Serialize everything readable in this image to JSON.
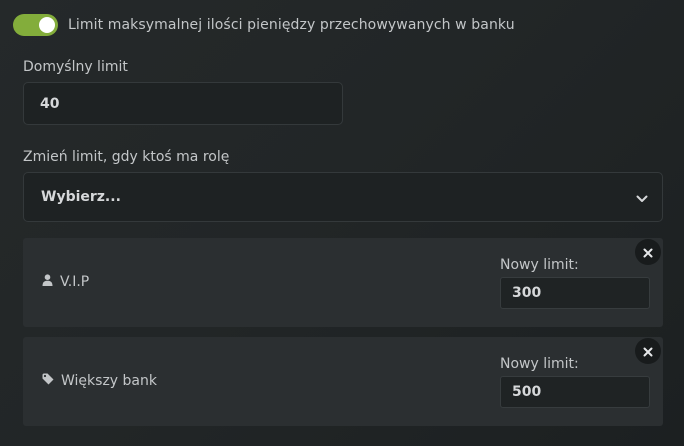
{
  "toggle": {
    "label": "Limit maksymalnej ilości pieniędzy przechowywanych w banku",
    "enabled": true,
    "color": "#83ad3b"
  },
  "default_limit": {
    "label": "Domyślny limit",
    "value": "40"
  },
  "role_select": {
    "label": "Zmień limit, gdy ktoś ma rolę",
    "placeholder": "Wybierz...",
    "icon": "chevron-down-icon"
  },
  "roles": [
    {
      "name": "V.I.P",
      "icon": "user-icon",
      "new_limit_label": "Nowy limit:",
      "value": "300",
      "remove_icon": "close-icon"
    },
    {
      "name": "Większy bank",
      "icon": "tag-icon",
      "new_limit_label": "Nowy limit:",
      "value": "500",
      "remove_icon": "close-icon"
    }
  ]
}
